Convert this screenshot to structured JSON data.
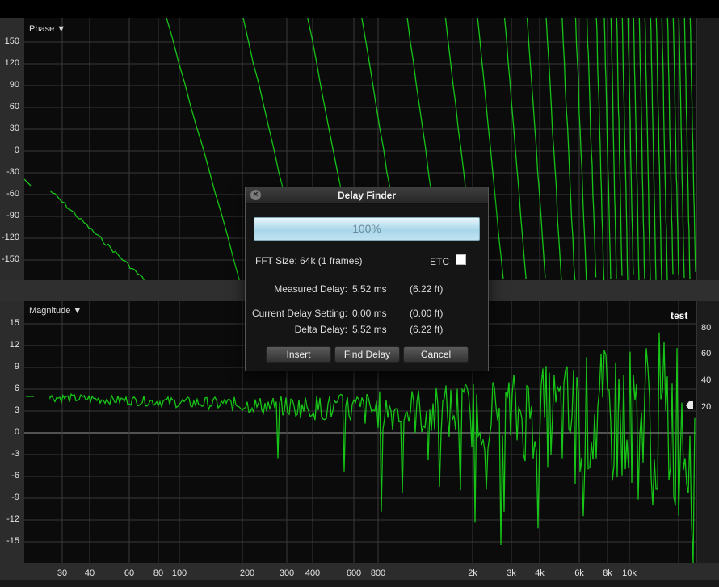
{
  "phase_plot": {
    "title": "Phase ▼",
    "y_ticks": [
      "150",
      "120",
      "90",
      "60",
      "30",
      "0",
      "-30",
      "-60",
      "-90",
      "-120",
      "-150"
    ],
    "x_ticks": [
      "30",
      "40",
      "60",
      "80",
      "100",
      "2",
      "3k",
      "4k",
      "6k",
      "8k",
      "10k"
    ]
  },
  "magnitude_plot": {
    "title": "Magnitude ▼",
    "series_tag": "test",
    "y_ticks": [
      "15",
      "12",
      "9",
      "6",
      "3",
      "0",
      "-3",
      "-6",
      "-9",
      "-12",
      "-15"
    ],
    "y_ticks_right": [
      "80",
      "60",
      "40",
      "20"
    ],
    "x_ticks": [
      "30",
      "40",
      "60",
      "80",
      "100",
      "200",
      "300",
      "400",
      "600",
      "800",
      "2k",
      "3k",
      "4k",
      "6k",
      "8k",
      "10k"
    ]
  },
  "dialog": {
    "title": "Delay Finder",
    "progress_label": "100%",
    "progress_value": 100,
    "fft_size": "FFT Size: 64k (1 frames)",
    "etc_label": "ETC",
    "measured_label": "Measured Delay:",
    "measured_ms": "5.52 ms",
    "measured_ft": "(6.22 ft)",
    "current_label": "Current Delay Setting:",
    "current_ms": "0.00 ms",
    "current_ft": "(0.00 ft)",
    "delta_label": "Delta Delay:",
    "delta_ms": "5.52 ms",
    "delta_ft": "(6.22 ft)",
    "buttons": {
      "insert": "Insert",
      "find": "Find Delay",
      "cancel": "Cancel"
    }
  },
  "colors": {
    "trace": "#17c417",
    "grid": "#3a3a3a",
    "plot_bg": "#0b0b0b"
  }
}
